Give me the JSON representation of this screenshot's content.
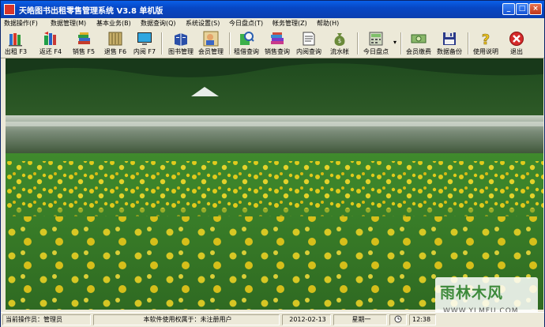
{
  "window": {
    "title": "天皓图书出租零售管理系统  V3.8  单机版",
    "controls": {
      "minimize": "_",
      "maximize": "□",
      "close": "×"
    }
  },
  "menu": [
    "数据操作(F)",
    "数据管理(M)",
    "基本业务(B)",
    "数据查询(Q)",
    "系统设置(S)",
    "今日盘点(T)",
    "帐务管理(Z)",
    "帮助(H)"
  ],
  "toolbar": {
    "buttons": [
      {
        "label": "出租 F3",
        "icon": "books-rent-icon"
      },
      {
        "label": "返还 F4",
        "icon": "books-return-icon"
      },
      {
        "label": "销售 F5",
        "icon": "books-sale-icon"
      },
      {
        "label": "退售 F6",
        "icon": "books-refund-icon"
      },
      {
        "label": "内阅 F7",
        "icon": "monitor-icon"
      },
      {
        "label": "图书管理",
        "icon": "book-manage-icon"
      },
      {
        "label": "会员管理",
        "icon": "member-icon"
      },
      {
        "label": "租借查询",
        "icon": "rent-query-icon"
      },
      {
        "label": "销售查询",
        "icon": "sale-query-icon"
      },
      {
        "label": "内阅查询",
        "icon": "read-query-icon"
      },
      {
        "label": "流水帐",
        "icon": "money-bag-icon"
      },
      {
        "label": "今日盘点",
        "icon": "calculator-icon"
      },
      {
        "label": "会员缴费",
        "icon": "cash-icon"
      },
      {
        "label": "数据备份",
        "icon": "floppy-icon"
      },
      {
        "label": "使用说明",
        "icon": "help-icon"
      },
      {
        "label": "退出",
        "icon": "exit-icon"
      }
    ],
    "dropdown_arrow": "▾"
  },
  "status": {
    "operator": "当前操作员：管理员",
    "license": "本软件使用权属于：未注册用户",
    "date": "2012-02-13",
    "weekday": "星期一",
    "time": "12:38"
  },
  "watermark": {
    "line1": "雨林木风",
    "line2": "WWW.YLMFU.COM"
  },
  "colors": {
    "titlebar": "#0747C5",
    "face": "#ECE9D8",
    "grass": "#3b7a32",
    "flower": "#f2d21a"
  }
}
